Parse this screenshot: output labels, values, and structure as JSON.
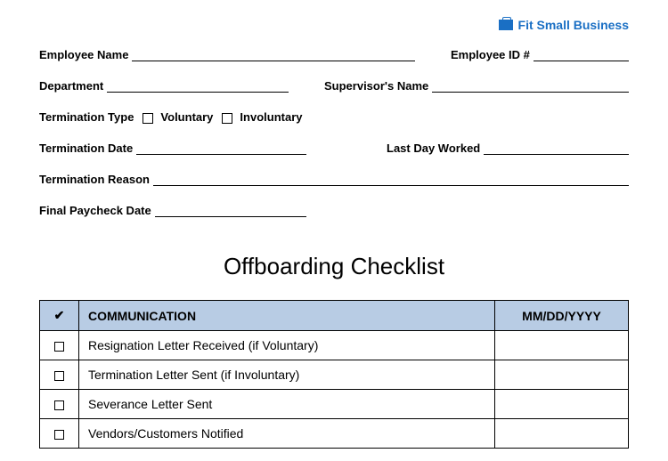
{
  "brand": "Fit Small Business",
  "fields": {
    "employee_name": "Employee Name",
    "employee_id": "Employee ID #",
    "department": "Department",
    "supervisor": "Supervisor's Name",
    "termination_type": "Termination Type",
    "voluntary": "Voluntary",
    "involuntary": "Involuntary",
    "termination_date": "Termination Date",
    "last_day": "Last Day Worked",
    "termination_reason": "Termination Reason",
    "final_paycheck": "Final Paycheck Date"
  },
  "title": "Offboarding Checklist",
  "table": {
    "check_header": "✔",
    "section_header": "COMMUNICATION",
    "date_header": "MM/DD/YYYY",
    "rows": [
      "Resignation Letter Received (if Voluntary)",
      "Termination Letter Sent (if Involuntary)",
      "Severance Letter Sent",
      "Vendors/Customers Notified"
    ]
  }
}
